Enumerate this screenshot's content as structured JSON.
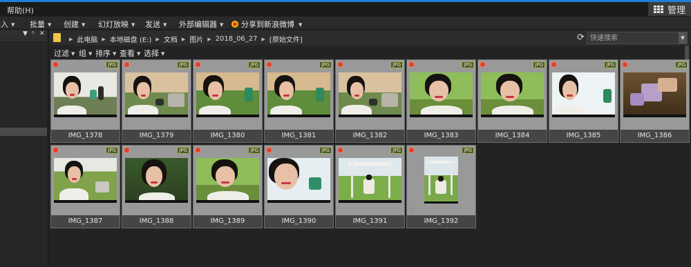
{
  "menubar": {
    "help": "帮助(H)"
  },
  "manage": {
    "label": "管理"
  },
  "toolbar": {
    "items": [
      "导入",
      "批量",
      "创建",
      "幻灯放映",
      "发送",
      "外部编辑器"
    ],
    "share": "分享到新浪微博"
  },
  "path": {
    "crumbs": [
      "此电脑",
      "本地磁盘 (E:)",
      "文档",
      "图片",
      "2018_06_27",
      "[原始文件]"
    ]
  },
  "search": {
    "placeholder": "快速搜索"
  },
  "filters": [
    "过滤",
    "组",
    "排序",
    "查看",
    "选择"
  ],
  "badge_label": "JPG",
  "thumbnails": [
    {
      "name": "IMG_1378",
      "scene": "face-left"
    },
    {
      "name": "IMG_1379",
      "scene": "face-left-sand"
    },
    {
      "name": "IMG_1380",
      "scene": "face-left-green"
    },
    {
      "name": "IMG_1381",
      "scene": "face-left-green"
    },
    {
      "name": "IMG_1382",
      "scene": "face-left-sand"
    },
    {
      "name": "IMG_1383",
      "scene": "face-center-green"
    },
    {
      "name": "IMG_1384",
      "scene": "face-center-green"
    },
    {
      "name": "IMG_1385",
      "scene": "face-left-sky"
    },
    {
      "name": "IMG_1386",
      "scene": "hands-ground"
    },
    {
      "name": "IMG_1387",
      "scene": "face-left-field"
    },
    {
      "name": "IMG_1388",
      "scene": "face-center-dark"
    },
    {
      "name": "IMG_1389",
      "scene": "face-center-green"
    },
    {
      "name": "IMG_1390",
      "scene": "face-closeup"
    },
    {
      "name": "IMG_1391",
      "scene": "swing-wide"
    },
    {
      "name": "IMG_1392",
      "scene": "swing-portrait"
    }
  ],
  "colors": {
    "accent": "#1f7fd6",
    "reject": "#d8452e",
    "badge": "#4d5a2c",
    "folder": "#f0c44a"
  }
}
